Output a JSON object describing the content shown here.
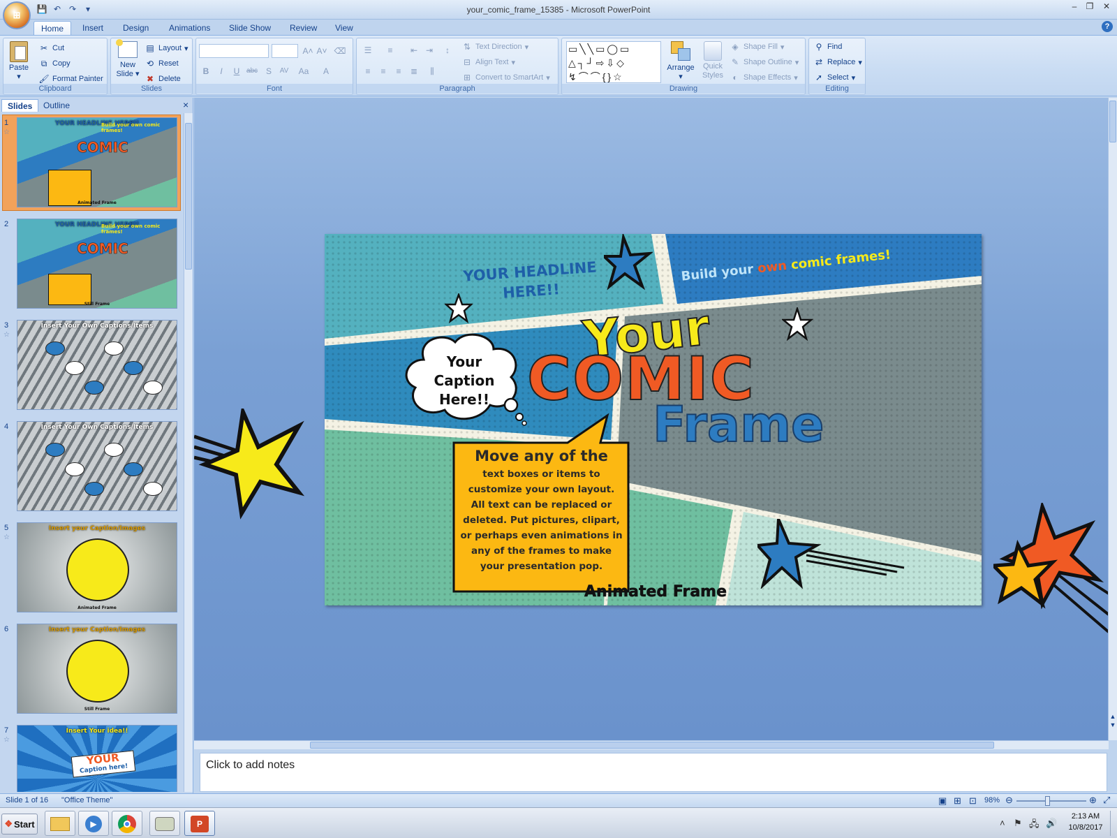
{
  "window": {
    "title": "your_comic_frame_15385 - Microsoft PowerPoint",
    "office_button_label": "⊞",
    "help_label": "?"
  },
  "tabs": [
    "Home",
    "Insert",
    "Design",
    "Animations",
    "Slide Show",
    "Review",
    "View"
  ],
  "ribbon": {
    "clipboard": {
      "label": "Clipboard",
      "paste": "Paste",
      "cut": "Cut",
      "copy": "Copy",
      "format_painter": "Format Painter"
    },
    "slides": {
      "label": "Slides",
      "new_slide_line1": "New",
      "new_slide_line2": "Slide",
      "layout": "Layout",
      "reset": "Reset",
      "delete": "Delete"
    },
    "font": {
      "label": "Font"
    },
    "paragraph": {
      "label": "Paragraph",
      "text_direction": "Text Direction",
      "align_text": "Align Text",
      "convert_smartart": "Convert to SmartArt"
    },
    "drawing": {
      "label": "Drawing",
      "arrange": "Arrange",
      "quick_styles_line1": "Quick",
      "quick_styles_line2": "Styles",
      "shape_fill": "Shape Fill",
      "shape_outline": "Shape Outline",
      "shape_effects": "Shape Effects"
    },
    "editing": {
      "label": "Editing",
      "find": "Find",
      "replace": "Replace",
      "select": "Select"
    }
  },
  "pane": {
    "tabs": [
      "Slides",
      "Outline"
    ],
    "close": "×",
    "thumbnails": [
      {
        "num": "1",
        "title": "YOUR HEADLINE HERE!!",
        "sub": "Build your own comic frames!",
        "footer": "Animated Frame"
      },
      {
        "num": "2",
        "title": "YOUR HEADLINE HERE!!",
        "sub": "Build your own comic frames!",
        "footer": "Still Frame"
      },
      {
        "num": "3",
        "title": "Insert Your Own Captions/Items"
      },
      {
        "num": "4",
        "title": "Insert Your Own Captions/Items"
      },
      {
        "num": "5",
        "title": "Insert your Caption/Images",
        "footer": "Animated Frame"
      },
      {
        "num": "6",
        "title": "Insert your Caption/Images",
        "footer": "Still Frame"
      },
      {
        "num": "7",
        "title": "Insert Your idea!!",
        "caption1": "YOUR",
        "caption2": "Caption here!"
      }
    ]
  },
  "slide": {
    "headline_line1": "YOUR HEADLINE",
    "headline_line2": "HERE!!",
    "banner_part1": "Build your",
    "banner_part2": "own",
    "banner_part3": "comic frames!",
    "cloud_line1": "Your",
    "cloud_line2": "Caption",
    "cloud_line3": "Here!!",
    "title_your": "Your",
    "title_comic": "COMIC",
    "title_frame": "Frame",
    "box_heading": "Move any of the",
    "box_body": [
      "text boxes or items to",
      "customize your own layout.",
      "All text can be replaced or",
      "deleted. Put pictures, clipart,",
      "or perhaps even animations in",
      "any of the frames to make",
      "your presentation pop."
    ],
    "footer": "Animated Frame"
  },
  "notes": {
    "placeholder": "Click to add notes"
  },
  "status": {
    "slide_of": "Slide 1 of 16",
    "theme": "\"Office Theme\"",
    "zoom": "98%"
  },
  "taskbar": {
    "start": "Start",
    "time": "2:13 AM",
    "date": "10/8/2017"
  },
  "colors": {
    "teal": "#54b1bf",
    "blue": "#2d7cc1",
    "gray": "#7a8b8d",
    "green": "#6fbfa0",
    "yellow": "#f7ea1a",
    "orange": "#f05a24",
    "box": "#fcb812"
  }
}
